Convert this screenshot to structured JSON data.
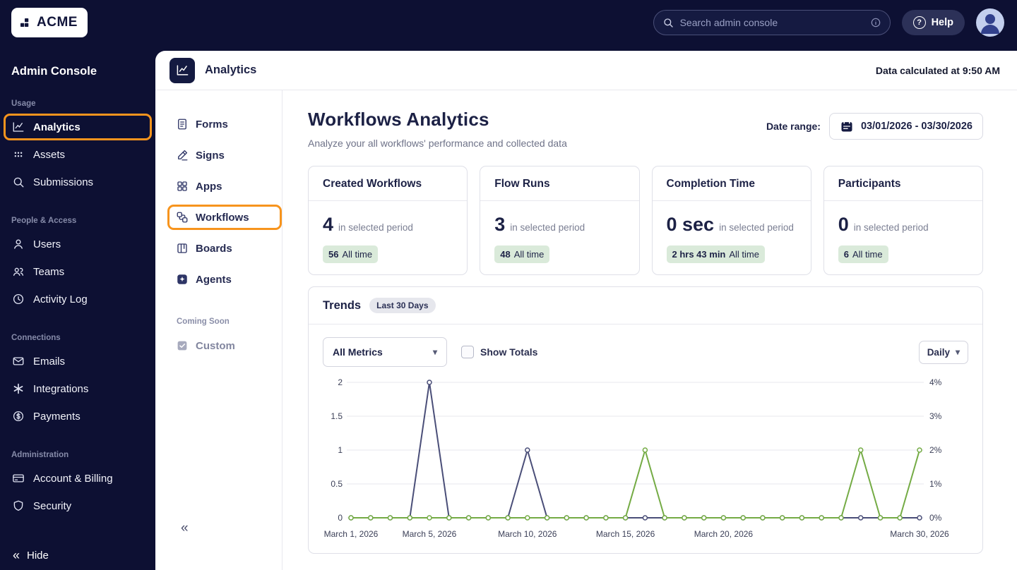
{
  "topbar": {
    "brand": "ACME",
    "search_placeholder": "Search admin console",
    "help_label": "Help"
  },
  "sidebar": {
    "title": "Admin Console",
    "sections": [
      {
        "label": "Usage",
        "items": [
          {
            "label": "Analytics"
          },
          {
            "label": "Assets"
          },
          {
            "label": "Submissions"
          }
        ]
      },
      {
        "label": "People & Access",
        "items": [
          {
            "label": "Users"
          },
          {
            "label": "Teams"
          },
          {
            "label": "Activity Log"
          }
        ]
      },
      {
        "label": "Connections",
        "items": [
          {
            "label": "Emails"
          },
          {
            "label": "Integrations"
          },
          {
            "label": "Payments"
          }
        ]
      },
      {
        "label": "Administration",
        "items": [
          {
            "label": "Account & Billing"
          },
          {
            "label": "Security"
          }
        ]
      }
    ],
    "hide_label": "Hide"
  },
  "panel_header": {
    "title": "Analytics",
    "note": "Data calculated at 9:50 AM"
  },
  "subnav": {
    "items": [
      "Forms",
      "Signs",
      "Apps",
      "Workflows",
      "Boards",
      "Agents"
    ],
    "coming_soon": "Coming Soon",
    "coming_items": [
      "Custom"
    ]
  },
  "main": {
    "title": "Workflows Analytics",
    "subtitle": "Analyze your all workflows' performance and collected data",
    "date_range_label": "Date range:",
    "date_range_value": "03/01/2026 - 03/30/2026",
    "cards": [
      {
        "title": "Created Workflows",
        "value": "4",
        "caption": "in selected period",
        "badge_value": "56",
        "badge_label": "All time"
      },
      {
        "title": "Flow Runs",
        "value": "3",
        "caption": "in selected period",
        "badge_value": "48",
        "badge_label": "All time"
      },
      {
        "title": "Completion Time",
        "value": "0 sec",
        "caption": "in selected period",
        "badge_value": "2 hrs 43 min",
        "badge_label": "All time"
      },
      {
        "title": "Participants",
        "value": "0",
        "caption": "in selected period",
        "badge_value": "6",
        "badge_label": "All time"
      }
    ],
    "trends": {
      "title": "Trends",
      "range_badge": "Last 30 Days",
      "metric": "All Metrics",
      "show_totals": "Show Totals",
      "interval": "Daily"
    }
  },
  "chart_data": {
    "type": "line",
    "x_unit": "day",
    "days": 30,
    "x_tick_labels": [
      {
        "day": 1,
        "label": "March 1, 2026"
      },
      {
        "day": 5,
        "label": "March 5, 2026"
      },
      {
        "day": 10,
        "label": "March 10, 2026"
      },
      {
        "day": 15,
        "label": "March 15, 2026"
      },
      {
        "day": 20,
        "label": "March 20, 2026"
      },
      {
        "day": 30,
        "label": "March 30, 2026"
      }
    ],
    "left_axis": {
      "ticks": [
        0,
        0.5,
        1,
        1.5,
        2
      ],
      "max": 2
    },
    "right_axis": {
      "ticks": [
        "0%",
        "1%",
        "2%",
        "3%",
        "4%"
      ],
      "max": 4
    },
    "grid": true,
    "legend": "none",
    "series": [
      {
        "name": "count-series",
        "color": "#4a4e78",
        "axis": "left",
        "values": [
          0,
          0,
          0,
          0,
          2,
          0,
          0,
          0,
          0,
          1,
          0,
          0,
          0,
          0,
          0,
          0,
          0,
          0,
          0,
          0,
          0,
          0,
          0,
          0,
          0,
          0,
          0,
          0,
          0,
          0
        ]
      },
      {
        "name": "percent-series",
        "color": "#74ab44",
        "axis": "right",
        "values": [
          0,
          0,
          0,
          0,
          0,
          0,
          0,
          0,
          0,
          0,
          0,
          0,
          0,
          0,
          0,
          1,
          0,
          0,
          0,
          0,
          0,
          0,
          0,
          0,
          0,
          0,
          1,
          0,
          0,
          1
        ]
      }
    ]
  }
}
